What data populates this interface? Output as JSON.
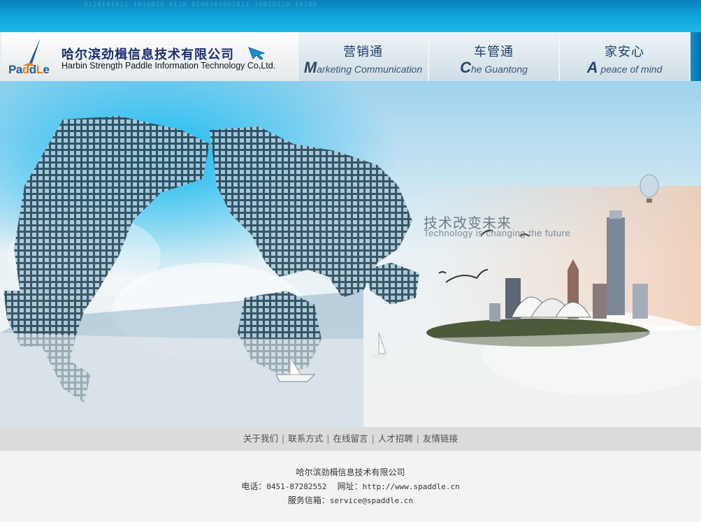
{
  "company": {
    "name_cn": "哈尔滨劲楫信息技术有限公司",
    "name_en": "Harbin Strength Paddle Information Technology Co,Ltd.",
    "logo_word": "PaddLe"
  },
  "nav": [
    {
      "cn": "营销通",
      "en_initial": "M",
      "en_rest": "arketing Communication"
    },
    {
      "cn": "车管通",
      "en_initial": "C",
      "en_rest": "he Guantong"
    },
    {
      "cn": "家安心",
      "en_initial": "A",
      "en_rest": " peace of mind"
    }
  ],
  "hero": {
    "slogan_cn": "技术改变未来",
    "slogan_en": "Technology is changing the future"
  },
  "links": [
    "关于我们",
    "联系方式",
    "在线留言",
    "人才招聘",
    "友情链接"
  ],
  "footer": {
    "name": "哈尔滨劲楫信息技术有限公司",
    "phone_label": "电话：",
    "phone": "0451-87282552",
    "site_label": "网址：",
    "site": "http://www.spaddle.cn",
    "email_label": "服务信箱：",
    "email": "service@spaddle.cn"
  },
  "colors": {
    "top_strip": "#12a6dc",
    "company_text": "#1d2e6e",
    "nav_text": "#1b3f73"
  }
}
